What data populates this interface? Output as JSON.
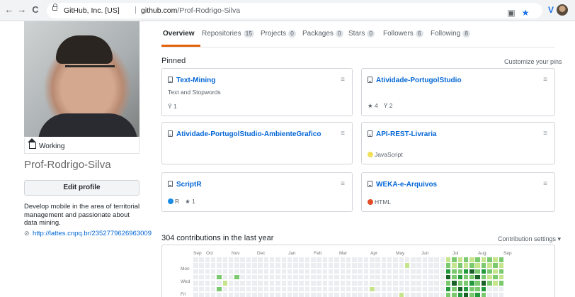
{
  "browser": {
    "back": "←",
    "forward": "→",
    "reload": "C",
    "site_org": "GitHub, Inc. [US]",
    "separator": "|",
    "host": "github.com",
    "path": "/Prof-Rodrigo-Silva"
  },
  "profile": {
    "status": "Working",
    "username": "Prof-Rodrigo-Silva",
    "edit_label": "Edit profile",
    "bio": "Develop mobile in the area of territorial management and passionate about data mining.",
    "link": "http://lattes.cnpq.br/2352779626963009"
  },
  "tabs": [
    {
      "label": "Overview",
      "count": ""
    },
    {
      "label": "Repositories",
      "count": "15"
    },
    {
      "label": "Projects",
      "count": "0"
    },
    {
      "label": "Packages",
      "count": "0"
    },
    {
      "label": "Stars",
      "count": "0"
    },
    {
      "label": "Followers",
      "count": "6"
    },
    {
      "label": "Following",
      "count": "8"
    }
  ],
  "pinned": {
    "title": "Pinned",
    "customize": "Customize your pins",
    "repos": [
      {
        "name": "Text-Mining",
        "desc": "Text and Stopwords",
        "lang": "",
        "lang_color": "",
        "stars": "",
        "forks": "1"
      },
      {
        "name": "Atividade-PortugolStudio",
        "desc": "",
        "lang": "",
        "lang_color": "",
        "stars": "4",
        "forks": "2"
      },
      {
        "name": "Atividade-PortugolStudio-AmbienteGrafico",
        "desc": "",
        "lang": "",
        "lang_color": "",
        "stars": "",
        "forks": ""
      },
      {
        "name": "API-REST-Livraria",
        "desc": "",
        "lang": "JavaScript",
        "lang_color": "#f1e05a",
        "stars": "",
        "forks": ""
      },
      {
        "name": "ScriptR",
        "desc": "",
        "lang": "R",
        "lang_color": "#198ce7",
        "stars": "1",
        "forks": ""
      },
      {
        "name": "WEKA-e-Arquivos",
        "desc": "",
        "lang": "HTML",
        "lang_color": "#e34c26",
        "stars": "",
        "forks": ""
      }
    ]
  },
  "contributions": {
    "title": "304 contributions in the last year",
    "settings": "Contribution settings ▾",
    "months": [
      "Sep",
      "Oct",
      "Nov",
      "Dec",
      "Jan",
      "Feb",
      "Mar",
      "Apr",
      "May",
      "Jun",
      "Jul",
      "Aug",
      "Sep"
    ],
    "weekdays": [
      "Mon",
      "Wed",
      "Fri"
    ],
    "colors": [
      "#ebedf0",
      "#c6e48b",
      "#7bc96f",
      "#239a3b",
      "#196127"
    ]
  }
}
